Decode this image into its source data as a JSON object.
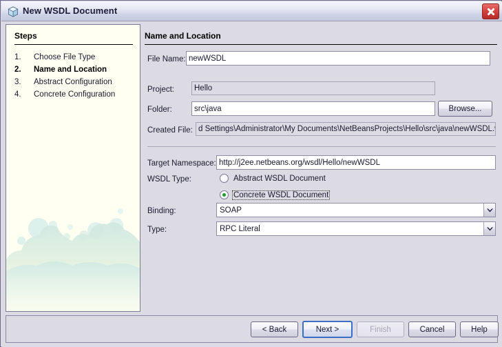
{
  "window": {
    "title": "New WSDL Document",
    "icon": "cube-icon",
    "close_label": "Close"
  },
  "steps": {
    "heading": "Steps",
    "items": [
      {
        "num": "1.",
        "label": "Choose File Type",
        "current": false
      },
      {
        "num": "2.",
        "label": "Name and Location",
        "current": true
      },
      {
        "num": "3.",
        "label": "Abstract Configuration",
        "current": false
      },
      {
        "num": "4.",
        "label": "Concrete Configuration",
        "current": false
      }
    ]
  },
  "panel": {
    "title": "Name and Location",
    "file_name": {
      "label": "File Name:",
      "value": "newWSDL"
    },
    "project": {
      "label": "Project:",
      "value": "Hello"
    },
    "folder": {
      "label": "Folder:",
      "value": "src\\java",
      "browse_label": "Browse..."
    },
    "created_file": {
      "label": "Created File:",
      "value": "d Settings\\Administrator\\My Documents\\NetBeansProjects\\Hello\\src\\java\\newWSDL.wsdl"
    },
    "target_namespace": {
      "label": "Target Namespace:",
      "value": "http://j2ee.netbeans.org/wsdl/Hello/newWSDL"
    },
    "wsdl_type": {
      "label": "WSDL Type:",
      "options": [
        {
          "label": "Abstract WSDL Document",
          "checked": false,
          "focused": false
        },
        {
          "label": "Concrete WSDL Document",
          "checked": true,
          "focused": true
        }
      ]
    },
    "binding": {
      "label": "Binding:",
      "value": "SOAP"
    },
    "type": {
      "label": "Type:",
      "value": "RPC Literal"
    }
  },
  "buttons": {
    "back": "< Back",
    "next": "Next >",
    "finish": "Finish",
    "cancel": "Cancel",
    "help": "Help"
  },
  "colors": {
    "accent": "#3a6fc4",
    "radio_dot": "#1b9e2b",
    "close": "#d54440",
    "steps_bg": "#fffff2",
    "dialog_bg": "#dcdae2"
  }
}
